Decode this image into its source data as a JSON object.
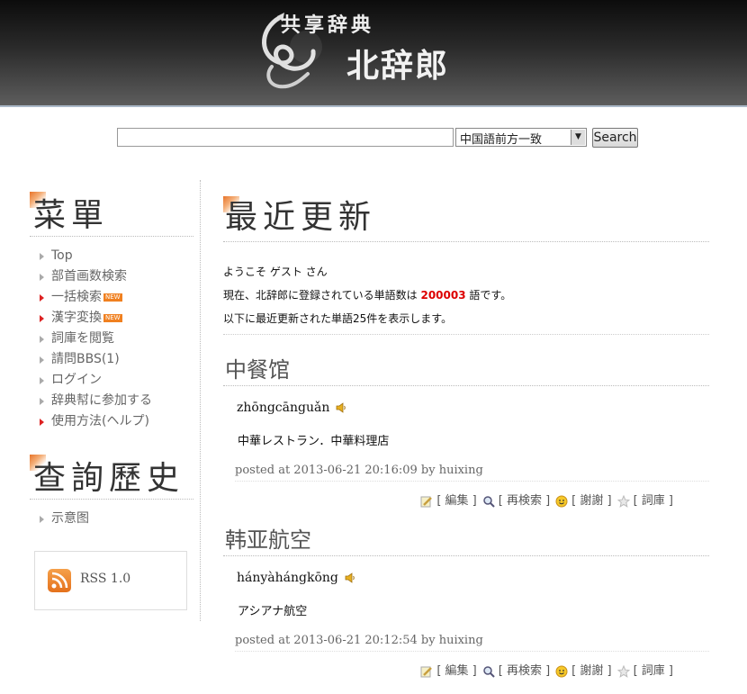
{
  "header": {
    "logo_small": "共享辞典",
    "logo_big": "北辞郎"
  },
  "search": {
    "query": "",
    "mode_selected": "中国語前方一致",
    "button_label": "Search"
  },
  "sidebar": {
    "menu_title": "菜單",
    "menu_items": [
      {
        "label": "Top",
        "marker": "gray",
        "badge": ""
      },
      {
        "label": "部首画数検索",
        "marker": "gray",
        "badge": ""
      },
      {
        "label": "一括検索",
        "marker": "red",
        "badge": "NEW"
      },
      {
        "label": "漢字変換",
        "marker": "red",
        "badge": "NEW"
      },
      {
        "label": "詞庫を閲覧",
        "marker": "gray",
        "badge": ""
      },
      {
        "label": "請問BBS(1)",
        "marker": "gray",
        "badge": ""
      },
      {
        "label": "ログイン",
        "marker": "gray",
        "badge": ""
      },
      {
        "label": "辞典幇に参加する",
        "marker": "gray",
        "badge": ""
      },
      {
        "label": "使用方法(ヘルプ)",
        "marker": "red",
        "badge": ""
      }
    ],
    "history_title": "查詢歷史",
    "history_items": [
      {
        "label": "示意图"
      }
    ],
    "rss_label": "RSS 1.0"
  },
  "main": {
    "title": "最近更新",
    "welcome": "ようこそ ゲスト さん",
    "count_prefix": "現在、北辞郎に登録されている単語数は ",
    "count_value": "200003",
    "count_suffix": " 語です。",
    "recent_note": "以下に最近更新された単語25件を表示します。",
    "entries": [
      {
        "word": "中餐馆",
        "pinyin": "zhōngcānguǎn",
        "meaning": "中華レストラン．中華料理店",
        "posted": "posted at 2013-06-21 20:16:09 by huixing",
        "actions": [
          "[ 編集 ]",
          "[ 再検索 ]",
          "[ 謝謝 ]",
          "[ 詞庫 ]"
        ]
      },
      {
        "word": "韩亚航空",
        "pinyin": "hányàhángkōng",
        "meaning": "アシアナ航空",
        "posted": "posted at 2013-06-21 20:12:54 by huixing",
        "actions": [
          "[ 編集 ]",
          "[ 再検索 ]",
          "[ 謝謝 ]",
          "[ 詞庫 ]"
        ]
      }
    ]
  },
  "colors": {
    "count_red": "#dd0000",
    "marker_red": "#dd2222",
    "accent_orange": "#e8742a"
  }
}
